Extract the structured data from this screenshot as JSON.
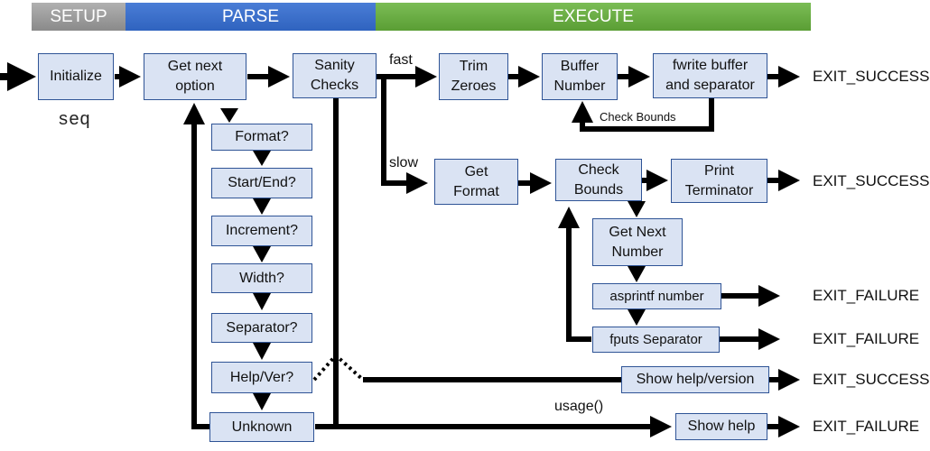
{
  "phases": {
    "setup": "SETUP",
    "parse": "PARSE",
    "execute": "EXECUTE"
  },
  "program_name": "seq",
  "nodes": {
    "initialize": "Initialize",
    "get_next_option": "Get next\noption",
    "sanity_checks": "Sanity\nChecks",
    "format_q": "Format?",
    "start_end_q": "Start/End?",
    "increment_q": "Increment?",
    "width_q": "Width?",
    "separator_q": "Separator?",
    "help_ver_q": "Help/Ver?",
    "unknown": "Unknown",
    "trim_zeroes": "Trim\nZeroes",
    "buffer_number": "Buffer\nNumber",
    "fwrite_buffer": "fwrite buffer\nand separator",
    "get_format": "Get\nFormat",
    "check_bounds": "Check\nBounds",
    "print_terminator": "Print\nTerminator",
    "get_next_number": "Get Next\nNumber",
    "asprintf_number": "asprintf number",
    "fputs_separator": "fputs Separator",
    "show_help_version": "Show help/version",
    "show_help": "Show help"
  },
  "edge_labels": {
    "fast": "fast",
    "slow": "slow",
    "check_bounds_loop": "Check Bounds",
    "usage": "usage()"
  },
  "exits": {
    "fast_exit": "EXIT_SUCCESS",
    "slow_exit": "EXIT_SUCCESS",
    "asprintf_exit": "EXIT_FAILURE",
    "fputs_exit": "EXIT_FAILURE",
    "help_version_exit": "EXIT_SUCCESS",
    "show_help_exit": "EXIT_FAILURE"
  }
}
